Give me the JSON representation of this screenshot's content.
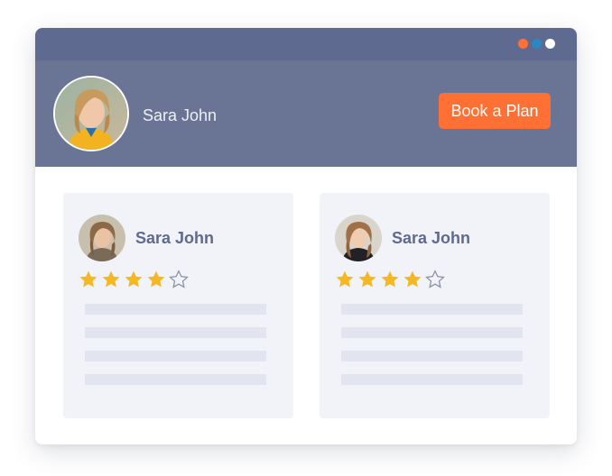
{
  "window": {
    "dots": [
      {
        "name": "orange-dot",
        "color": "#ff7034"
      },
      {
        "name": "blue-dot",
        "color": "#2b86c5"
      },
      {
        "name": "white-dot",
        "color": "#ffffff"
      }
    ]
  },
  "header": {
    "profile_name": "Sara John",
    "book_button_label": "Book a Plan",
    "accent_color": "#ff7034"
  },
  "reviews": [
    {
      "name": "Sara John",
      "rating": 4,
      "max_rating": 5
    },
    {
      "name": "Sara John",
      "rating": 4,
      "max_rating": 5
    }
  ]
}
